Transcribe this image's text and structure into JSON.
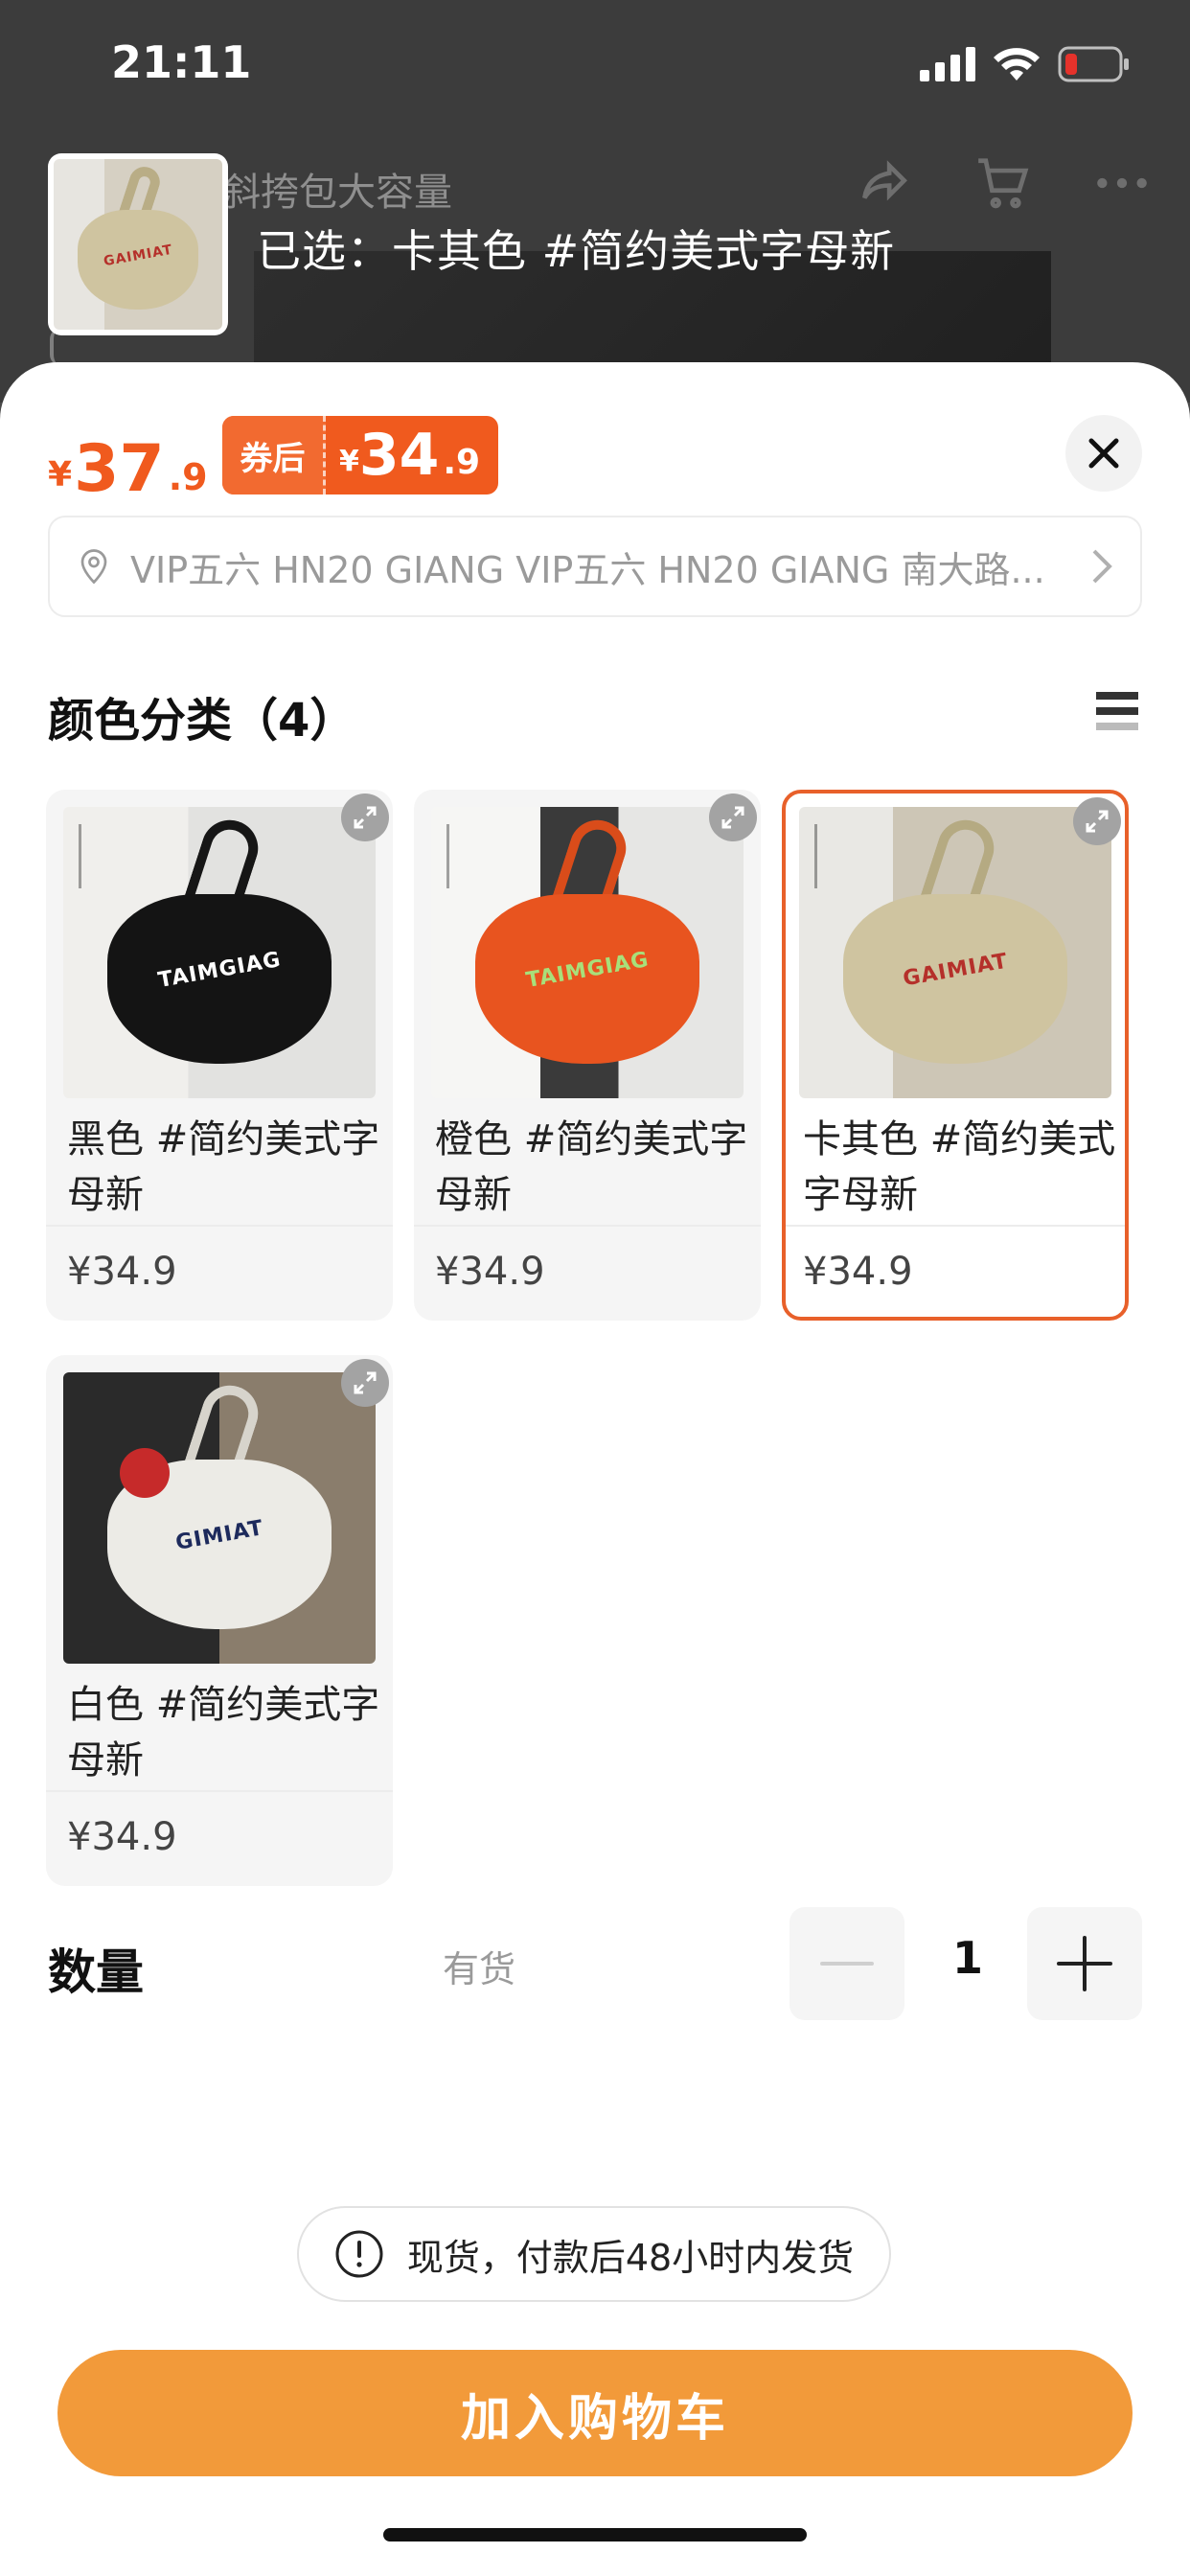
{
  "status_bar": {
    "time": "21:11"
  },
  "background": {
    "title": "斜挎包大容量"
  },
  "selected": {
    "label": "已选：卡其色 #简约美式字母新"
  },
  "price": {
    "currency": "¥",
    "integer": "37",
    "decimal": ".9",
    "coupon_tag": "券后",
    "coupon_currency": "¥",
    "coupon_integer": "34",
    "coupon_decimal": ".9"
  },
  "address": {
    "text": "VIP五六 HN20 GIANG VIP五六 HN20 GIANG 南大路..."
  },
  "category": {
    "title": "颜色分类（4）"
  },
  "variants": [
    {
      "name": "黑色 #简约美式字母新",
      "price": "¥34.9",
      "selected": false,
      "bag_color": "#141414",
      "print_color": "#ffffff",
      "print": "TAIMGIAG"
    },
    {
      "name": "橙色 #简约美式字母新",
      "price": "¥34.9",
      "selected": false,
      "bag_color": "#e8541f",
      "print_color": "#a8e07a",
      "print": "TAIMGIAG"
    },
    {
      "name": "卡其色 #简约美式字母新",
      "price": "¥34.9",
      "selected": true,
      "bag_color": "#cfc4a0",
      "print_color": "#b5302a",
      "print": "GAIMIAT"
    },
    {
      "name": "白色 #简约美式字母新",
      "price": "¥34.9",
      "selected": false,
      "bag_color": "#ecebe6",
      "print_color": "#1d2a5c",
      "print": "GIMIAT"
    }
  ],
  "quantity": {
    "label": "数量",
    "stock": "有货",
    "value": "1"
  },
  "notice": {
    "text": "现货，付款后48小时内发货"
  },
  "cta": {
    "label": "加入购物车"
  },
  "colors": {
    "accent": "#f05a1e",
    "cta": "#f29a3a",
    "selected_border": "#e8602a"
  }
}
